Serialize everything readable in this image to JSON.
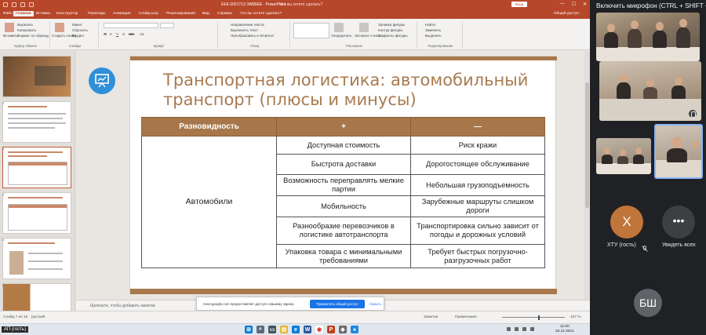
{
  "window": {
    "doc_title": "ЕЕК-2021Т12-ЗАБВЕЕ  -  PowerPoint",
    "search_hint": "Что вы хотите сделать?",
    "signin": "Вход",
    "controls": [
      "—",
      "☐",
      "✕"
    ]
  },
  "tabs": [
    {
      "label": "Файл"
    },
    {
      "label": "Главная"
    },
    {
      "label": "Вставка"
    },
    {
      "label": "Конструктор"
    },
    {
      "label": "Переходы"
    },
    {
      "label": "Анимация"
    },
    {
      "label": "Слайд-шоу"
    },
    {
      "label": "Рецензирование"
    },
    {
      "label": "Вид"
    },
    {
      "label": "Справка"
    },
    {
      "label": "Что вы хотите сделать?"
    }
  ],
  "share_label": "Общий доступ",
  "ribbon": {
    "groups": [
      {
        "label": "Буфер обмена",
        "buttons": [
          "Вставить",
          "Вырезать",
          "Копировать",
          "Формат по образцу"
        ]
      },
      {
        "label": "Слайды",
        "buttons": [
          "Создать слайд",
          "Макет",
          "Сбросить",
          "Раздел"
        ]
      },
      {
        "label": "Шрифт",
        "buttons": [
          "Ж",
          "К",
          "Ч",
          "S",
          "abc",
          "Aa"
        ]
      },
      {
        "label": "Абзац",
        "buttons": [
          "Направление текста",
          "Выровнять текст",
          "Преобразовать в SmartArt"
        ]
      },
      {
        "label": "Рисование",
        "buttons": [
          "Упорядочить",
          "Экспресс-стили",
          "Заливка фигуры",
          "Контур фигуры",
          "Эффекты фигуры"
        ]
      },
      {
        "label": "Редактирование",
        "buttons": [
          "Найти",
          "Заменить",
          "Выделить"
        ]
      }
    ]
  },
  "slide": {
    "title": "Транспортная логистика: автомобильный транспорт (плюсы и минусы)",
    "table": {
      "headers": [
        "Разновидность",
        "+",
        "—"
      ],
      "category": "Автомобили",
      "rows": [
        {
          "plus": "Доступная стоимость",
          "minus": "Риск кражи"
        },
        {
          "plus": "Быстрота доставки",
          "minus": "Дорогостоящее обслуживание"
        },
        {
          "plus": "Возможность переправлять мелкие партии",
          "minus": "Небольшая грузоподъемность"
        },
        {
          "plus": "Мобильность",
          "minus": "Зарубежные маршруты слишком дороги"
        },
        {
          "plus": "Разнообразие перевозчиков в логистике автотранспорта",
          "minus": "Транспортировка сильно зависит от погоды и дорожных условий"
        },
        {
          "plus": "Упаковка товара с минимальными требованиями",
          "minus": "Требует быстрых погрузочно-разгрузочных работ"
        }
      ]
    }
  },
  "thumbnails": [
    {
      "num": "1"
    },
    {
      "num": "2"
    },
    {
      "num": "3"
    },
    {
      "num": "4"
    },
    {
      "num": "5"
    },
    {
      "num": "6"
    }
  ],
  "notes_placeholder": "Щелкните, чтобы добавить заметки",
  "statusbar": {
    "slide_of": "Слайд 7 из 16",
    "language": "русский",
    "notes": "Заметки",
    "comments": "Примечания",
    "zoom": "107 %"
  },
  "share_banner": {
    "message": "meet.google.com предоставляет доступ к вашему экрану.",
    "primary": "Прекратить общий доступ",
    "secondary": "Скрыть"
  },
  "taskbar": {
    "active_label": "АП (гость)",
    "time": "11:00",
    "date": "23.11.2021"
  },
  "meeting": {
    "mic_banner": "Включить микрофон (CTRL + SHIFT + M)",
    "participant_initial": "Х",
    "participant_name": "ХТУ (гость)",
    "more_label": "Увидеть всех",
    "self_initials": "БШ",
    "colors": {
      "avatar_orange": "#c0753a",
      "avatar_gray": "#5f6368",
      "more_bg": "#3c4043"
    }
  }
}
